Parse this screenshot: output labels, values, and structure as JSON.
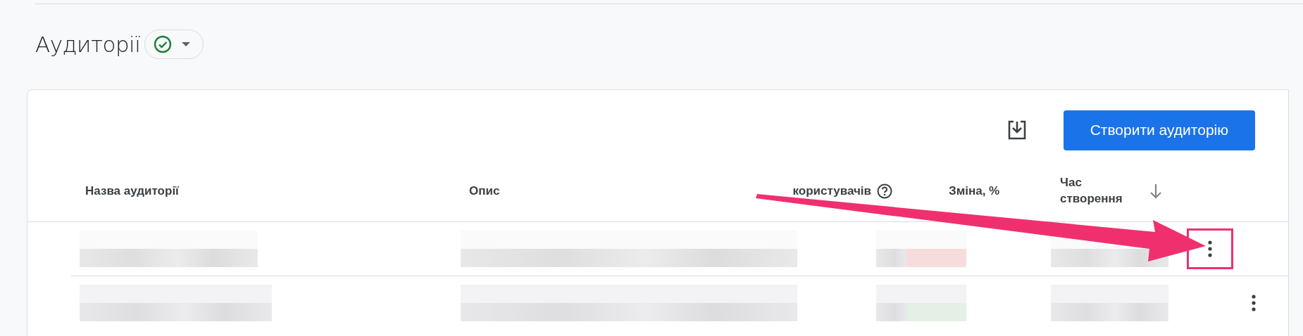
{
  "page": {
    "title": "Аудиторії",
    "status_ok": true
  },
  "toolbar": {
    "create_button": "Створити аудиторію"
  },
  "table": {
    "columns": [
      {
        "label": "Назва аудиторії",
        "kind": "text"
      },
      {
        "label": "Опис",
        "kind": "text"
      },
      {
        "label": "користувачів",
        "kind": "help"
      },
      {
        "label": "Зміна, %",
        "kind": "text"
      },
      {
        "label": "Час створення",
        "kind": "sorted"
      }
    ],
    "rows": [
      {
        "highlighted": true,
        "color": "#f7dcdc"
      },
      {
        "highlighted": false,
        "color": "#e4efe6"
      }
    ]
  },
  "annotation": {
    "kind": "arrow"
  }
}
